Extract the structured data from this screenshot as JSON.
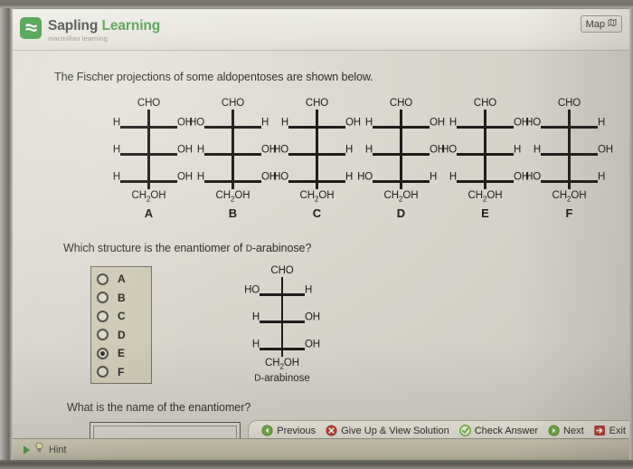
{
  "header": {
    "brand_primary": "Sapling",
    "brand_secondary": "Learning",
    "brand_subtitle": "macmillan learning",
    "logo_icon": "sapling-leaf-icon",
    "map_button": {
      "label": "Map",
      "icon": "map-icon"
    }
  },
  "content": {
    "intro_text": "The Fischer projections of some aldopentoses are shown below.",
    "question_text_prefix": "Which structure is the enantiomer of ",
    "question_text_dash": "D",
    "question_text_suffix": "-arabinose?",
    "name_question": "What is the name of the enantiomer?"
  },
  "fischer_projections": [
    {
      "letter": "A",
      "top": "CHO",
      "bottom": "CH2OH",
      "rungs": [
        {
          "left": "H",
          "right": "OH"
        },
        {
          "left": "H",
          "right": "OH"
        },
        {
          "left": "H",
          "right": "OH"
        }
      ]
    },
    {
      "letter": "B",
      "top": "CHO",
      "bottom": "CH2OH",
      "rungs": [
        {
          "left": "HO",
          "right": "H"
        },
        {
          "left": "H",
          "right": "OH"
        },
        {
          "left": "H",
          "right": "OH"
        }
      ]
    },
    {
      "letter": "C",
      "top": "CHO",
      "bottom": "CH2OH",
      "rungs": [
        {
          "left": "H",
          "right": "OH"
        },
        {
          "left": "HO",
          "right": "H"
        },
        {
          "left": "HO",
          "right": "H"
        }
      ]
    },
    {
      "letter": "D",
      "top": "CHO",
      "bottom": "CH2OH",
      "rungs": [
        {
          "left": "H",
          "right": "OH"
        },
        {
          "left": "H",
          "right": "OH"
        },
        {
          "left": "HO",
          "right": "H"
        }
      ]
    },
    {
      "letter": "E",
      "top": "CHO",
      "bottom": "CH2OH",
      "rungs": [
        {
          "left": "H",
          "right": "OH"
        },
        {
          "left": "HO",
          "right": "H"
        },
        {
          "left": "H",
          "right": "OH"
        }
      ]
    },
    {
      "letter": "F",
      "top": "CHO",
      "bottom": "CH2OH",
      "rungs": [
        {
          "left": "HO",
          "right": "H"
        },
        {
          "left": "H",
          "right": "OH"
        },
        {
          "left": "HO",
          "right": "H"
        }
      ]
    }
  ],
  "choices": [
    {
      "label": "A",
      "selected": false
    },
    {
      "label": "B",
      "selected": false
    },
    {
      "label": "C",
      "selected": false
    },
    {
      "label": "D",
      "selected": false
    },
    {
      "label": "E",
      "selected": true
    },
    {
      "label": "F",
      "selected": false
    }
  ],
  "reference_structure": {
    "name_dash": "D",
    "name_suffix": "-arabinose",
    "top": "CHO",
    "bottom": "CH2OH",
    "rungs": [
      {
        "left": "HO",
        "right": "H"
      },
      {
        "left": "H",
        "right": "OH"
      },
      {
        "left": "H",
        "right": "OH"
      }
    ]
  },
  "answer_field": {
    "value": "",
    "placeholder": ""
  },
  "hint_bar": {
    "label": "Hint",
    "icon": "lightbulb-icon",
    "expander_icon": "play-triangle-icon"
  },
  "actions": [
    {
      "label": "Previous",
      "icon": "arrow-left-circle-icon",
      "color": "#6cae3b"
    },
    {
      "label": "Give Up & View Solution",
      "icon": "x-circle-icon",
      "color": "#c0392b"
    },
    {
      "label": "Check Answer",
      "icon": "check-circle-icon",
      "color": "#6cae3b"
    },
    {
      "label": "Next",
      "icon": "arrow-right-circle-icon",
      "color": "#6cae3b"
    },
    {
      "label": "Exit",
      "icon": "exit-arrow-icon",
      "color": "#c0392b"
    }
  ],
  "colors": {
    "page_background": "#d7d5cc",
    "header_background": "#e9e7e0",
    "brand_green": "#3f9b44",
    "panel_background": "#cdc9b3",
    "hint_bar": "#c4c0a9",
    "text": "#2c2c29"
  }
}
